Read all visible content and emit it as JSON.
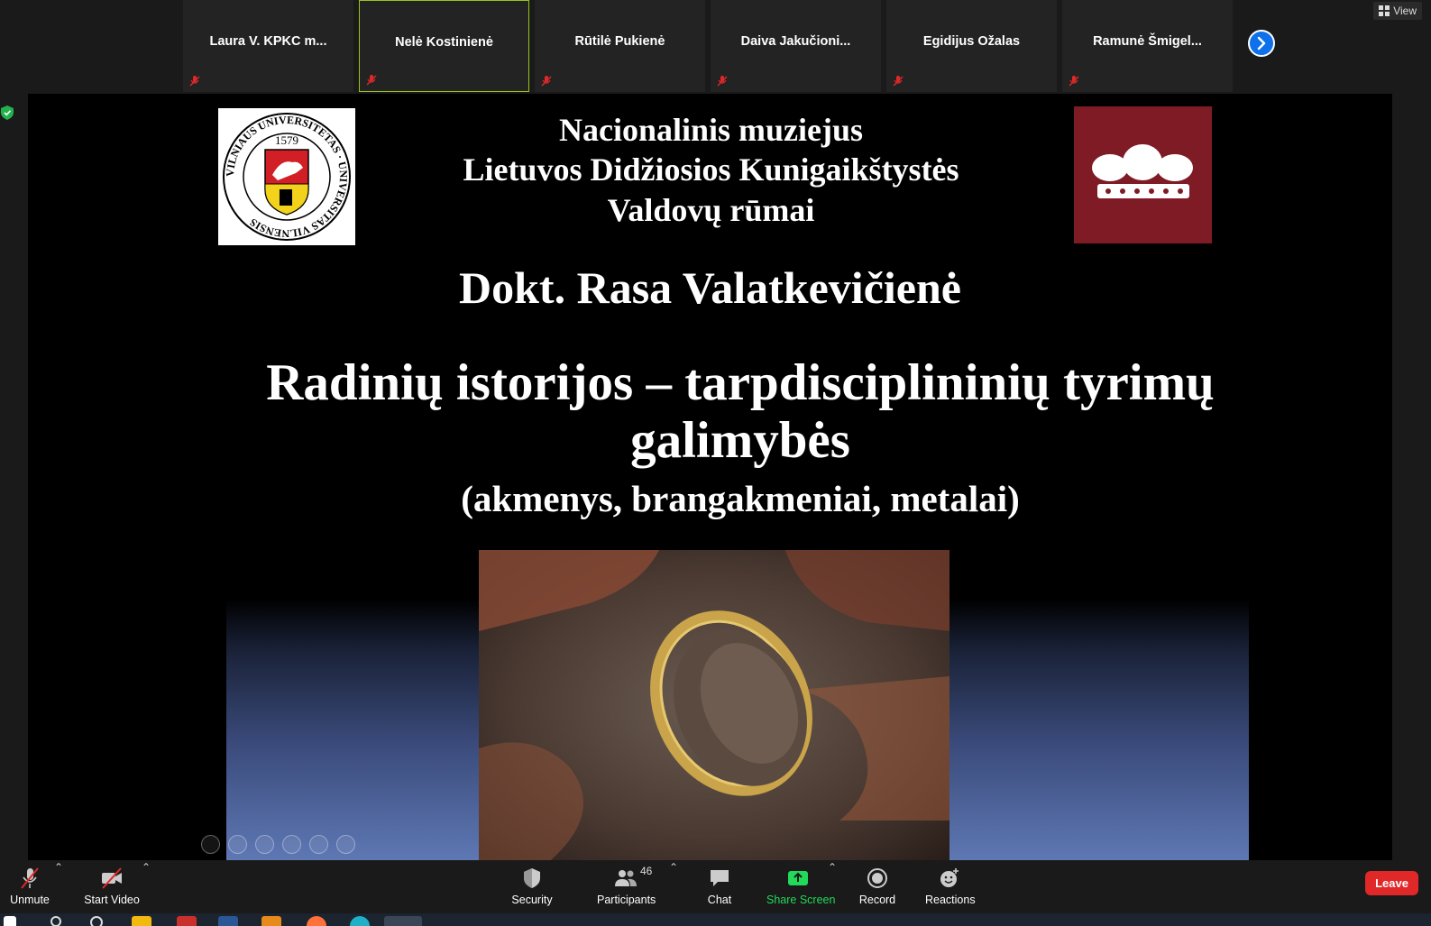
{
  "participants": [
    {
      "name": "Laura V. KPKC m...",
      "muted": true,
      "active": false
    },
    {
      "name": "Nelė Kostinienė",
      "muted": true,
      "active": true
    },
    {
      "name": "Rūtilė Pukienė",
      "muted": true,
      "active": false
    },
    {
      "name": "Daiva  Jakučioni...",
      "muted": true,
      "active": false
    },
    {
      "name": "Egidijus Ožalas",
      "muted": true,
      "active": false
    },
    {
      "name": "Ramunė  Šmigel...",
      "muted": true,
      "active": false
    }
  ],
  "view_button": "View",
  "slide": {
    "vu_logo": {
      "year": "1579",
      "ring_text": "VILNIAUS UNIVERSITETAS · UNIVERSITAS VILNENSIS"
    },
    "institution_line1": "Nacionalinis muziejus",
    "institution_line2": "Lietuvos Didžiosios Kunigaikštystės",
    "institution_line3": "Valdovų rūmai",
    "author": "Dokt. Rasa Valatkevičienė",
    "title_line1": "Radinių istorijos – tarpdisciplininių tyrimų",
    "title_line2": "galimybės",
    "subtitle": "(akmenys, brangakmeniai, metalai)"
  },
  "toolbar": {
    "unmute": "Unmute",
    "start_video": "Start Video",
    "security": "Security",
    "participants": "Participants",
    "participant_count": "46",
    "chat": "Chat",
    "share_screen": "Share Screen",
    "record": "Record",
    "reactions": "Reactions",
    "leave": "Leave"
  },
  "colors": {
    "active_speaker": "#9bc21c",
    "share_green": "#23d959",
    "leave_red": "#e02828",
    "brand_blue": "#0e71eb"
  }
}
